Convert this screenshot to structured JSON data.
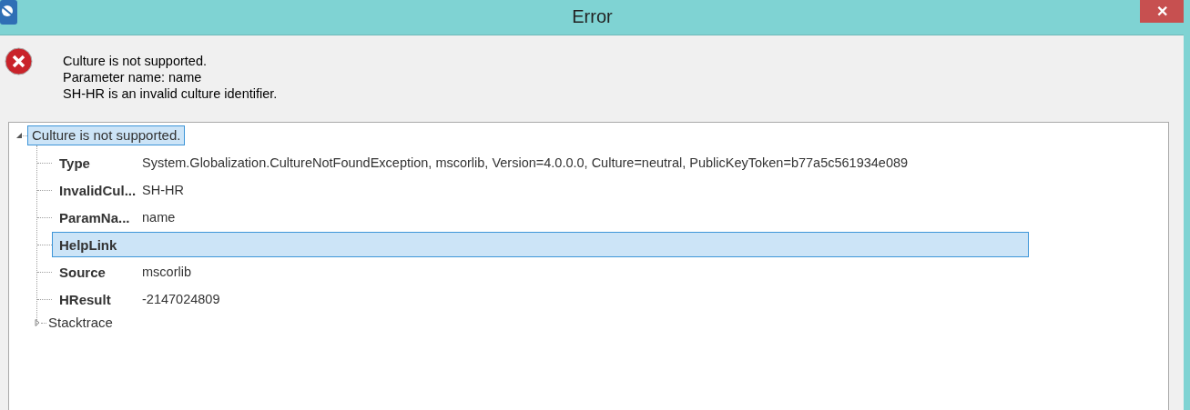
{
  "window": {
    "title": "Error",
    "close": "✕"
  },
  "message": {
    "lines": [
      "Culture is not supported.",
      "Parameter name: name",
      "SH-HR is an invalid culture identifier."
    ]
  },
  "tree": {
    "label": "Culture is not supported.",
    "expanded": true,
    "selected": true,
    "children": [
      {
        "kind": "property",
        "name": "Type",
        "value": "System.Globalization.CultureNotFoundException, mscorlib, Version=4.0.0.0, Culture=neutral, PublicKeyToken=b77a5c561934e089",
        "selected": false
      },
      {
        "kind": "property",
        "name": "InvalidCul...",
        "value": "SH-HR",
        "selected": false
      },
      {
        "kind": "property",
        "name": "ParamNa...",
        "value": "name",
        "selected": false
      },
      {
        "kind": "property",
        "name": "HelpLink",
        "selected": true
      },
      {
        "kind": "property",
        "name": "Source",
        "value": "mscorlib",
        "selected": false
      },
      {
        "kind": "property",
        "name": "HResult",
        "value": "-2147024809",
        "selected": false
      },
      {
        "kind": "node",
        "label": "Stacktrace",
        "expanded": false
      }
    ]
  }
}
